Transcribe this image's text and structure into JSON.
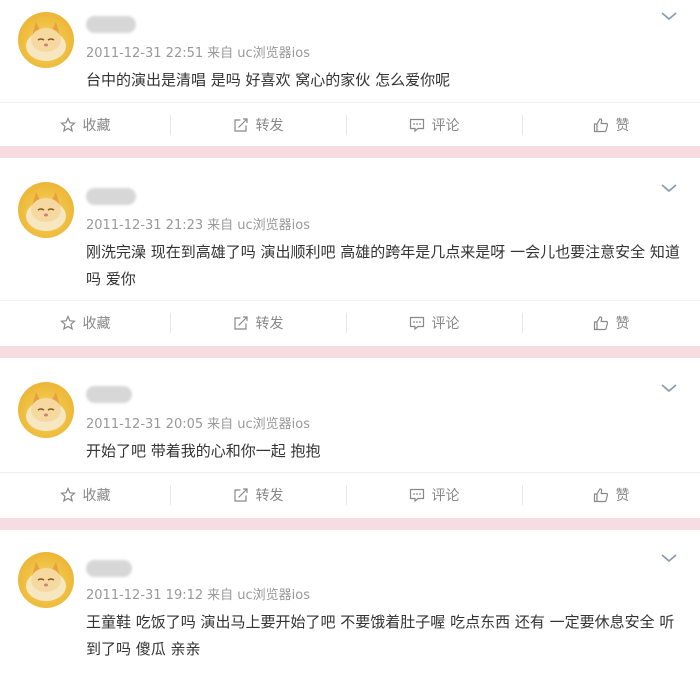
{
  "posts": [
    {
      "timestamp": "2011-12-31 22:51",
      "via": "来自 uc浏览器ios",
      "text": "台中的演出是清唱 是吗 好喜欢 窝心的家伙 怎么爱你呢"
    },
    {
      "timestamp": "2011-12-31 21:23",
      "via": "来自 uc浏览器ios",
      "text": "刚洗完澡 现在到高雄了吗 演出顺利吧 高雄的跨年是几点来是呀 一会儿也要注意安全 知道吗 爱你"
    },
    {
      "timestamp": "2011-12-31 20:05",
      "via": "来自 uc浏览器ios",
      "text": "开始了吧 带着我的心和你一起 抱抱"
    },
    {
      "timestamp": "2011-12-31 19:12",
      "via": "来自 uc浏览器ios",
      "text": "王童鞋 吃饭了吗 演出马上要开始了吧 不要饿着肚子喔 吃点东西 还有 一定要休息安全 听到了吗 傻瓜 亲亲"
    }
  ],
  "actions": {
    "favorite": "收藏",
    "repost": "转发",
    "comment": "评论",
    "like": "赞"
  },
  "colors": {
    "separator": "#f7dde2",
    "meta": "#999999",
    "action": "#888888"
  },
  "icons": [
    "star-icon",
    "repost-icon",
    "comment-icon",
    "thumbs-up-icon",
    "chevron-down-icon"
  ]
}
